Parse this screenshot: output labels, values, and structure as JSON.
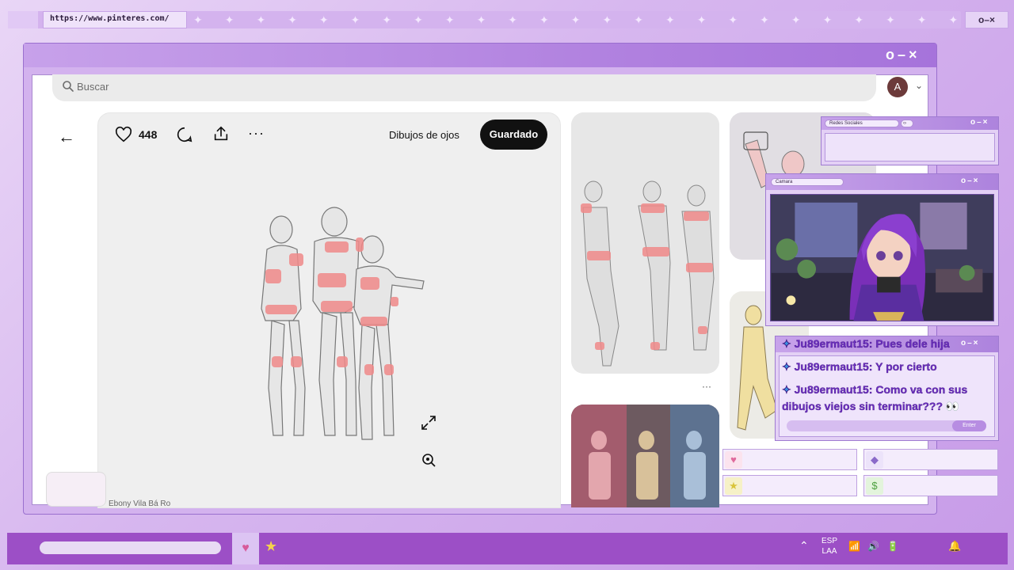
{
  "overlay_top": {
    "url": "https://www.pinteres.com/",
    "sparkles": "✦✦✦✦✦✦✦✦✦✦✦✦✦✦✦✦✦✦✦✦✦✦✦✦✦✦",
    "controls": "o–×"
  },
  "window": {
    "controls": "o–×"
  },
  "browser": {
    "search_placeholder": "Buscar",
    "avatar_letter": "A",
    "chevron": "⌄"
  },
  "pin": {
    "back": "←",
    "likes": "448",
    "more": "···",
    "board": "Dibujos de ojos",
    "saved_label": "Guardado",
    "author": "Ebony Vila Bá Ro",
    "grid_more": "···"
  },
  "overlays": {
    "redes_label": "Redes Sociales",
    "redes_controls": "o–×",
    "cam_label": "Camara",
    "cam_controls": "o–×",
    "chat_controls": "o–×",
    "chat_messages": [
      "Ju89ermaut15: Pues dele hija",
      "Ju89ermaut15: Y por cierto",
      "Ju89ermaut15: Como va con sus",
      "dibujos viejos sin terminar??? 👀"
    ],
    "chat_enter": "Enter",
    "stat_icons": [
      "♥",
      "◆",
      "★",
      "$"
    ]
  },
  "taskbar": {
    "heart": "♥",
    "star": "★",
    "tray_up": "⌃",
    "lang_1": "ESP",
    "lang_2": "LAA",
    "tray_icons": "📶 🔊 🔋",
    "bell": "🔔"
  },
  "colors": {
    "accent_purple": "#9c4fc6",
    "chat_text": "#6b2fbf",
    "saved_button": "#111111",
    "sketch_highlight": "#f08a8a"
  }
}
